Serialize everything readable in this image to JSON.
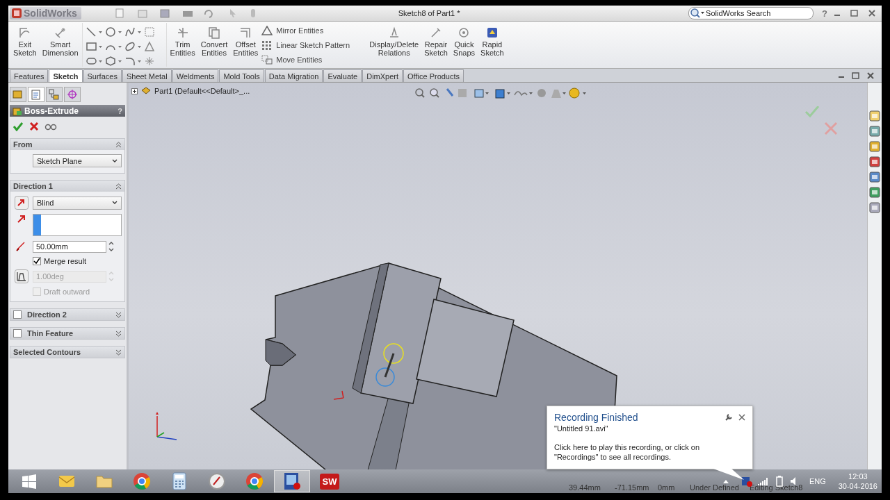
{
  "title_bar": {
    "app_name": "SolidWorks",
    "document_title": "Sketch8 of Part1 *",
    "search": {
      "placeholder": "SolidWorks Search"
    },
    "help": "?"
  },
  "ribbon": {
    "commands": [
      {
        "kind": "large",
        "label": "Exit\nSketch"
      },
      {
        "kind": "large",
        "label": "Smart\nDimension"
      },
      {
        "kind": "tools"
      },
      {
        "kind": "large",
        "label": "Trim\nEntities"
      },
      {
        "kind": "large",
        "label": "Convert\nEntities"
      },
      {
        "kind": "large",
        "label": "Offset\nEntities"
      },
      {
        "kind": "stack",
        "items": [
          "Mirror Entities",
          "Linear Sketch Pattern",
          "Move Entities"
        ]
      },
      {
        "kind": "large",
        "label": "Display/Delete\nRelations"
      },
      {
        "kind": "large",
        "label": "Repair\nSketch"
      },
      {
        "kind": "large",
        "label": "Quick\nSnaps"
      },
      {
        "kind": "large",
        "label": "Rapid\nSketch"
      }
    ]
  },
  "tabs": [
    {
      "label": "Features",
      "selected": false
    },
    {
      "label": "Sketch",
      "selected": true
    },
    {
      "label": "Surfaces",
      "selected": false
    },
    {
      "label": "Sheet Metal",
      "selected": false
    },
    {
      "label": "Weldments",
      "selected": false
    },
    {
      "label": "Mold Tools",
      "selected": false
    },
    {
      "label": "Data Migration",
      "selected": false
    },
    {
      "label": "Evaluate",
      "selected": false
    },
    {
      "label": "DimXpert",
      "selected": false
    },
    {
      "label": "Office Products",
      "selected": false
    }
  ],
  "property_manager": {
    "title": "Boss-Extrude",
    "help": "?",
    "sections": [
      {
        "kind": "from",
        "title": "From",
        "expanded": true,
        "start": "Sketch Plane"
      },
      {
        "kind": "direction",
        "title": "Direction 1",
        "expanded": true,
        "end_condition": "Blind",
        "depth": "50.00mm",
        "merge_label": "Merge result",
        "merge_result": true,
        "draft_on": false,
        "draft_angle": "1.00deg",
        "outward_label": "Draft outward",
        "outward": false
      },
      {
        "kind": "toggle",
        "title": "Direction 2",
        "expanded": false,
        "checked": false
      },
      {
        "kind": "toggle",
        "title": "Thin Feature",
        "expanded": false,
        "checked": false
      },
      {
        "kind": "plain",
        "title": "Selected Contours",
        "expanded": false
      }
    ]
  },
  "feature_tree": {
    "label": "Part1  (Default<<Default>_..."
  },
  "notification": {
    "title": "Recording Finished",
    "file": "\"Untitled 91.avi\"",
    "message": "Click here to play this recording, or click on \"Recordings\" to see all recordings."
  },
  "taskbar": {
    "apps": [
      {
        "kind": "start",
        "selected": false
      },
      {
        "kind": "mail",
        "selected": false
      },
      {
        "kind": "folder",
        "selected": false
      },
      {
        "kind": "browser",
        "selected": false
      },
      {
        "kind": "calculator",
        "selected": false
      },
      {
        "kind": "clock",
        "selected": false
      },
      {
        "kind": "browser",
        "selected": false
      },
      {
        "kind": "recorder",
        "selected": true
      },
      {
        "kind": "cad",
        "label": "SW",
        "selected": false
      }
    ]
  },
  "status_bar": {
    "items": [
      "39.44mm",
      "-71.15mm",
      "0mm",
      "Under Defined",
      "Editing Sketch8"
    ]
  },
  "tray": {
    "language": "ENG",
    "time": "12:03",
    "date": "30-04-2016"
  }
}
